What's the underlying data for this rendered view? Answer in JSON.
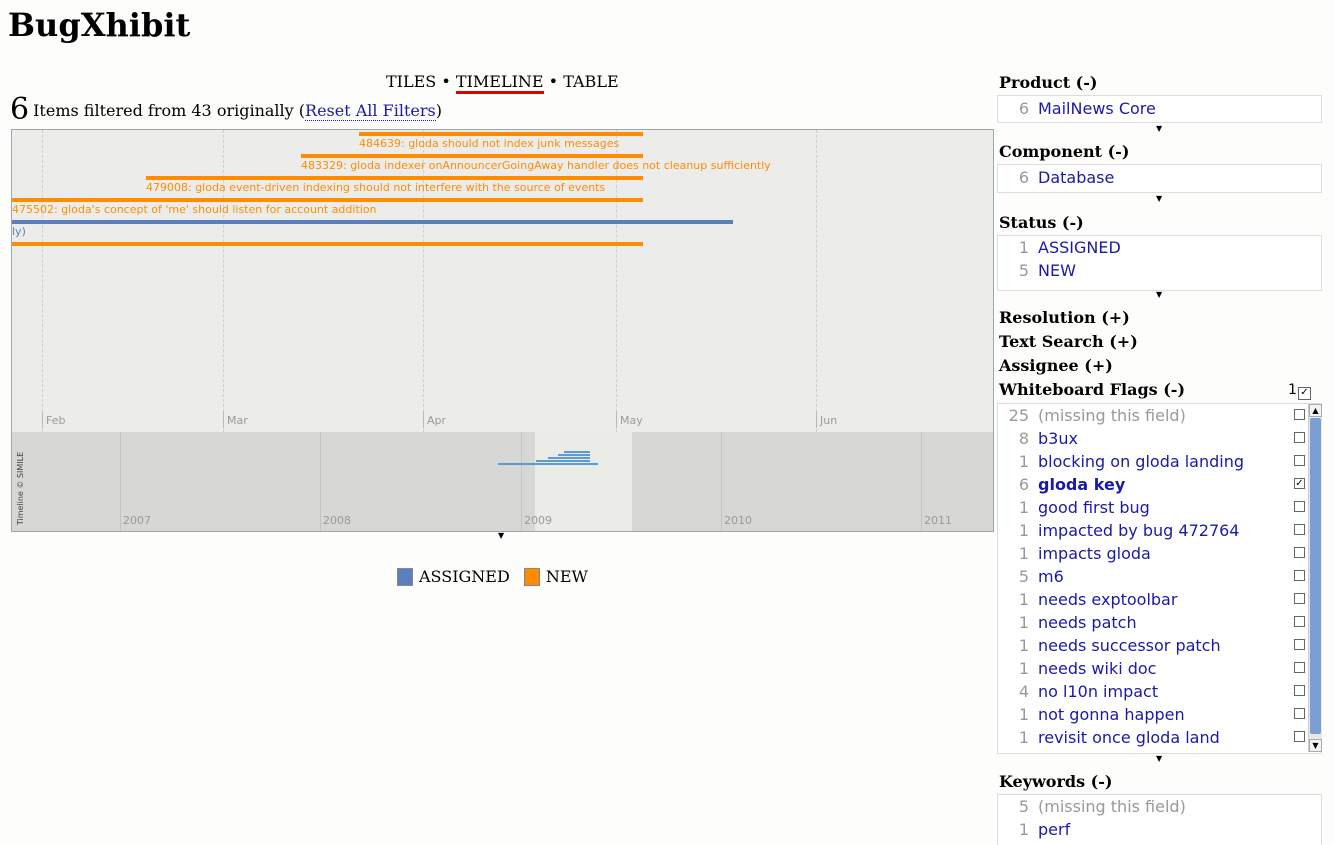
{
  "app": {
    "title": "BugXhibit"
  },
  "views": {
    "tiles": "TILES",
    "sep1": "•",
    "timeline": "TIMELINE",
    "sep2": "•",
    "table": "TABLE"
  },
  "summary": {
    "count": "6",
    "text": "Items filtered from 43 originally (",
    "reset": "Reset All Filters",
    "close": ")"
  },
  "timeline": {
    "upper_ticks": [
      "Feb",
      "Mar",
      "Apr",
      "May",
      "Jun"
    ],
    "lower_ticks": [
      "2007",
      "2008",
      "2009",
      "2010",
      "2011"
    ],
    "events": [
      {
        "label": "484639: gloda should not index junk messages",
        "status": "NEW"
      },
      {
        "label": "483329: gloda indexer onAnnouncerGoingAway handler does not cleanup sufficiently",
        "status": "NEW"
      },
      {
        "label": "479008: gloda event-driven indexing should not interfere with the source of events",
        "status": "NEW"
      },
      {
        "label": "475502: gloda's concept of 'me' should listen for account addition",
        "status": "NEW"
      },
      {
        "label": "ly)",
        "status": "ASSIGNED"
      }
    ],
    "copyright": "Timeline © SIMILE"
  },
  "legend": [
    {
      "label": "ASSIGNED",
      "color": "#5b7fbd"
    },
    {
      "label": "NEW",
      "color": "#ff8c00"
    }
  ],
  "facets": {
    "product": {
      "title": "Product (-)",
      "items": [
        {
          "count": "6",
          "value": "MailNews Core"
        }
      ]
    },
    "component": {
      "title": "Component (-)",
      "items": [
        {
          "count": "6",
          "value": "Database"
        }
      ]
    },
    "status": {
      "title": "Status (-)",
      "items": [
        {
          "count": "1",
          "value": "ASSIGNED"
        },
        {
          "count": "5",
          "value": "NEW"
        }
      ]
    },
    "resolution": {
      "title": "Resolution (+)"
    },
    "text_search": {
      "title": "Text Search (+)"
    },
    "assignee": {
      "title": "Assignee (+)"
    },
    "whiteboard": {
      "title": "Whiteboard Flags (-)",
      "selected_count": "1",
      "items": [
        {
          "count": "25",
          "value": "(missing this field)",
          "checked": false
        },
        {
          "count": "8",
          "value": "b3ux",
          "checked": false
        },
        {
          "count": "1",
          "value": "blocking on gloda landing",
          "checked": false
        },
        {
          "count": "6",
          "value": "gloda key",
          "checked": true
        },
        {
          "count": "1",
          "value": "good first bug",
          "checked": false
        },
        {
          "count": "1",
          "value": "impacted by bug 472764",
          "checked": false
        },
        {
          "count": "1",
          "value": "impacts gloda",
          "checked": false
        },
        {
          "count": "5",
          "value": "m6",
          "checked": false
        },
        {
          "count": "1",
          "value": "needs exptoolbar",
          "checked": false
        },
        {
          "count": "1",
          "value": "needs patch",
          "checked": false
        },
        {
          "count": "1",
          "value": "needs successor patch",
          "checked": false
        },
        {
          "count": "1",
          "value": "needs wiki doc",
          "checked": false
        },
        {
          "count": "4",
          "value": "no l10n impact",
          "checked": false
        },
        {
          "count": "1",
          "value": "not gonna happen",
          "checked": false
        },
        {
          "count": "1",
          "value": "revisit once gloda land",
          "checked": false
        }
      ]
    },
    "keywords": {
      "title": "Keywords (-)",
      "items": [
        {
          "count": "5",
          "value": "(missing this field)"
        },
        {
          "count": "1",
          "value": "perf"
        }
      ]
    }
  },
  "colors": {
    "new": "#ff8c00",
    "assigned": "#5b7fbd",
    "link": "#1a1aa6",
    "active_tab": "#dd0000"
  }
}
